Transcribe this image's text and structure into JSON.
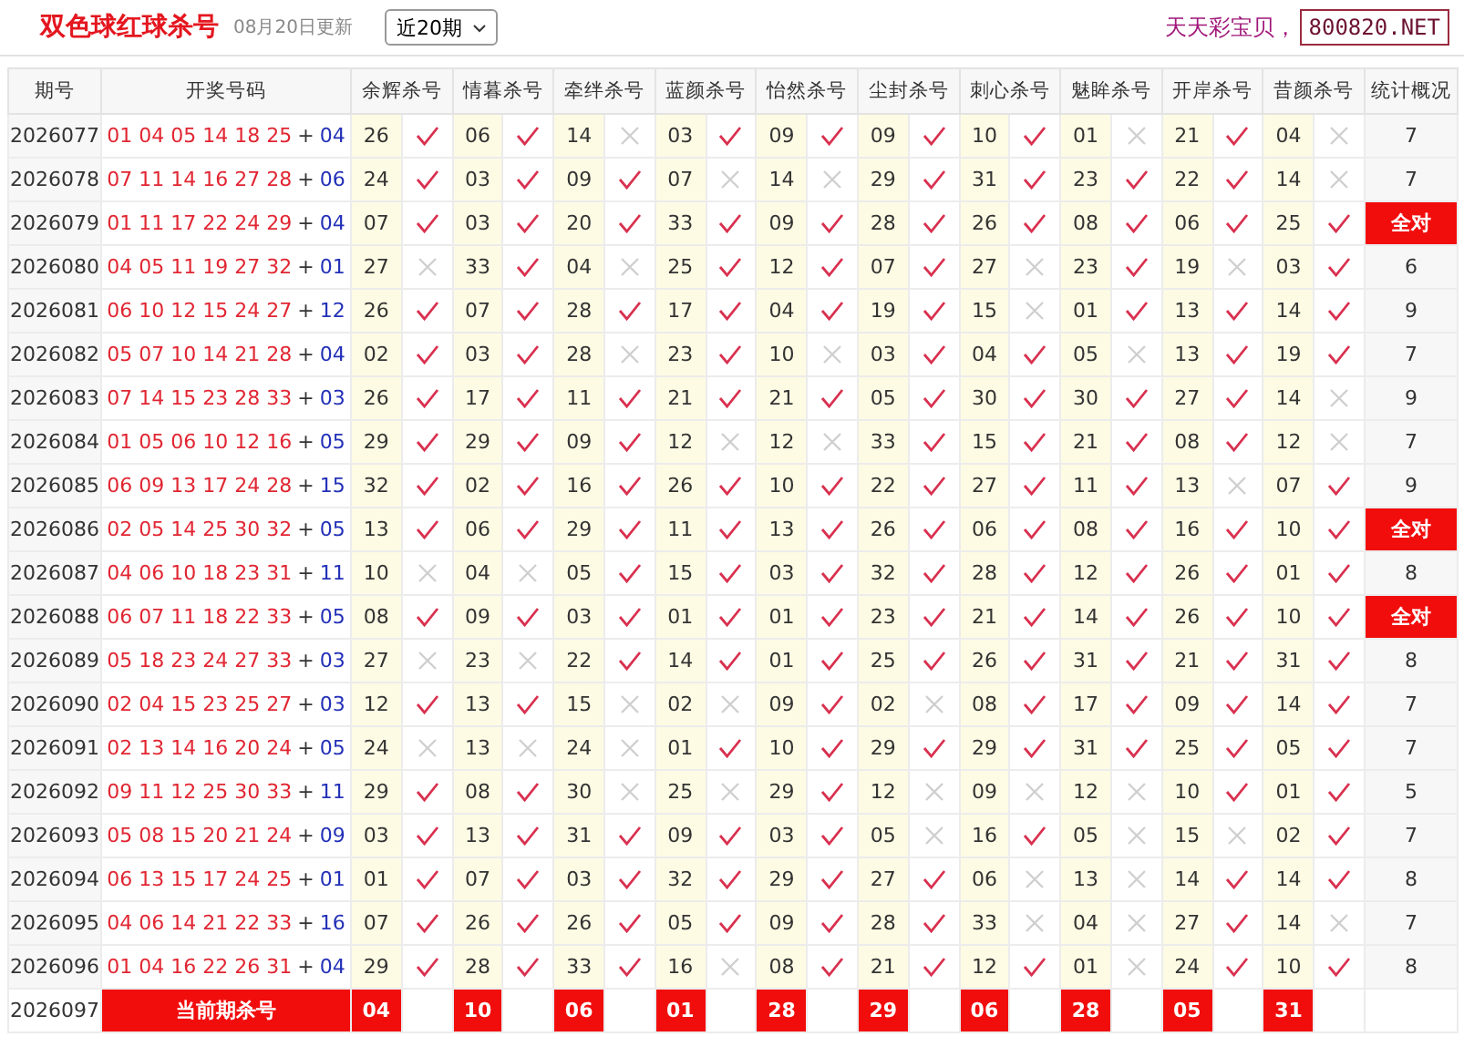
{
  "header": {
    "title": "双色球红球杀号",
    "updated": "08月20日更新",
    "period_select": {
      "value": "近20期"
    },
    "promo": "天天彩宝贝，",
    "site": "800820.NET"
  },
  "table": {
    "columns": [
      "期号",
      "开奖号码",
      "余辉杀号",
      "情暮杀号",
      "牵绊杀号",
      "蓝颜杀号",
      "怡然杀号",
      "尘封杀号",
      "刺心杀号",
      "魅眸杀号",
      "开岸杀号",
      "昔颜杀号",
      "统计概况"
    ],
    "rows": [
      {
        "issue": "2026077",
        "red": "01 04 05 14 18 25",
        "plus": "+",
        "blue": "04",
        "kills": [
          {
            "number": "26",
            "hit": true
          },
          {
            "number": "06",
            "hit": true
          },
          {
            "number": "14",
            "hit": false
          },
          {
            "number": "03",
            "hit": true
          },
          {
            "number": "09",
            "hit": true
          },
          {
            "number": "09",
            "hit": true
          },
          {
            "number": "10",
            "hit": true
          },
          {
            "number": "01",
            "hit": false
          },
          {
            "number": "21",
            "hit": true
          },
          {
            "number": "04",
            "hit": false
          }
        ],
        "summary": "7",
        "highlight": false
      },
      {
        "issue": "2026078",
        "red": "07 11 14 16 27 28",
        "plus": "+",
        "blue": "06",
        "kills": [
          {
            "number": "24",
            "hit": true
          },
          {
            "number": "03",
            "hit": true
          },
          {
            "number": "09",
            "hit": true
          },
          {
            "number": "07",
            "hit": false
          },
          {
            "number": "14",
            "hit": false
          },
          {
            "number": "29",
            "hit": true
          },
          {
            "number": "31",
            "hit": true
          },
          {
            "number": "23",
            "hit": true
          },
          {
            "number": "22",
            "hit": true
          },
          {
            "number": "14",
            "hit": false
          }
        ],
        "summary": "7",
        "highlight": false
      },
      {
        "issue": "2026079",
        "red": "01 11 17 22 24 29",
        "plus": "+",
        "blue": "04",
        "kills": [
          {
            "number": "07",
            "hit": true
          },
          {
            "number": "03",
            "hit": true
          },
          {
            "number": "20",
            "hit": true
          },
          {
            "number": "33",
            "hit": true
          },
          {
            "number": "09",
            "hit": true
          },
          {
            "number": "28",
            "hit": true
          },
          {
            "number": "26",
            "hit": true
          },
          {
            "number": "08",
            "hit": true
          },
          {
            "number": "06",
            "hit": true
          },
          {
            "number": "25",
            "hit": true
          }
        ],
        "summary": "全对",
        "highlight": true
      },
      {
        "issue": "2026080",
        "red": "04 05 11 19 27 32",
        "plus": "+",
        "blue": "01",
        "kills": [
          {
            "number": "27",
            "hit": false
          },
          {
            "number": "33",
            "hit": true
          },
          {
            "number": "04",
            "hit": false
          },
          {
            "number": "25",
            "hit": true
          },
          {
            "number": "12",
            "hit": true
          },
          {
            "number": "07",
            "hit": true
          },
          {
            "number": "27",
            "hit": false
          },
          {
            "number": "23",
            "hit": true
          },
          {
            "number": "19",
            "hit": false
          },
          {
            "number": "03",
            "hit": true
          }
        ],
        "summary": "6",
        "highlight": false
      },
      {
        "issue": "2026081",
        "red": "06 10 12 15 24 27",
        "plus": "+",
        "blue": "12",
        "kills": [
          {
            "number": "26",
            "hit": true
          },
          {
            "number": "07",
            "hit": true
          },
          {
            "number": "28",
            "hit": true
          },
          {
            "number": "17",
            "hit": true
          },
          {
            "number": "04",
            "hit": true
          },
          {
            "number": "19",
            "hit": true
          },
          {
            "number": "15",
            "hit": false
          },
          {
            "number": "01",
            "hit": true
          },
          {
            "number": "13",
            "hit": true
          },
          {
            "number": "14",
            "hit": true
          }
        ],
        "summary": "9",
        "highlight": false
      },
      {
        "issue": "2026082",
        "red": "05 07 10 14 21 28",
        "plus": "+",
        "blue": "04",
        "kills": [
          {
            "number": "02",
            "hit": true
          },
          {
            "number": "03",
            "hit": true
          },
          {
            "number": "28",
            "hit": false
          },
          {
            "number": "23",
            "hit": true
          },
          {
            "number": "10",
            "hit": false
          },
          {
            "number": "03",
            "hit": true
          },
          {
            "number": "04",
            "hit": true
          },
          {
            "number": "05",
            "hit": false
          },
          {
            "number": "13",
            "hit": true
          },
          {
            "number": "19",
            "hit": true
          }
        ],
        "summary": "7",
        "highlight": false
      },
      {
        "issue": "2026083",
        "red": "07 14 15 23 28 33",
        "plus": "+",
        "blue": "03",
        "kills": [
          {
            "number": "26",
            "hit": true
          },
          {
            "number": "17",
            "hit": true
          },
          {
            "number": "11",
            "hit": true
          },
          {
            "number": "21",
            "hit": true
          },
          {
            "number": "21",
            "hit": true
          },
          {
            "number": "05",
            "hit": true
          },
          {
            "number": "30",
            "hit": true
          },
          {
            "number": "30",
            "hit": true
          },
          {
            "number": "27",
            "hit": true
          },
          {
            "number": "14",
            "hit": false
          }
        ],
        "summary": "9",
        "highlight": false
      },
      {
        "issue": "2026084",
        "red": "01 05 06 10 12 16",
        "plus": "+",
        "blue": "05",
        "kills": [
          {
            "number": "29",
            "hit": true
          },
          {
            "number": "29",
            "hit": true
          },
          {
            "number": "09",
            "hit": true
          },
          {
            "number": "12",
            "hit": false
          },
          {
            "number": "12",
            "hit": false
          },
          {
            "number": "33",
            "hit": true
          },
          {
            "number": "15",
            "hit": true
          },
          {
            "number": "21",
            "hit": true
          },
          {
            "number": "08",
            "hit": true
          },
          {
            "number": "12",
            "hit": false
          }
        ],
        "summary": "7",
        "highlight": false
      },
      {
        "issue": "2026085",
        "red": "06 09 13 17 24 28",
        "plus": "+",
        "blue": "15",
        "kills": [
          {
            "number": "32",
            "hit": true
          },
          {
            "number": "02",
            "hit": true
          },
          {
            "number": "16",
            "hit": true
          },
          {
            "number": "26",
            "hit": true
          },
          {
            "number": "10",
            "hit": true
          },
          {
            "number": "22",
            "hit": true
          },
          {
            "number": "27",
            "hit": true
          },
          {
            "number": "11",
            "hit": true
          },
          {
            "number": "13",
            "hit": false
          },
          {
            "number": "07",
            "hit": true
          }
        ],
        "summary": "9",
        "highlight": false
      },
      {
        "issue": "2026086",
        "red": "02 05 14 25 30 32",
        "plus": "+",
        "blue": "05",
        "kills": [
          {
            "number": "13",
            "hit": true
          },
          {
            "number": "06",
            "hit": true
          },
          {
            "number": "29",
            "hit": true
          },
          {
            "number": "11",
            "hit": true
          },
          {
            "number": "13",
            "hit": true
          },
          {
            "number": "26",
            "hit": true
          },
          {
            "number": "06",
            "hit": true
          },
          {
            "number": "08",
            "hit": true
          },
          {
            "number": "16",
            "hit": true
          },
          {
            "number": "10",
            "hit": true
          }
        ],
        "summary": "全对",
        "highlight": true
      },
      {
        "issue": "2026087",
        "red": "04 06 10 18 23 31",
        "plus": "+",
        "blue": "11",
        "kills": [
          {
            "number": "10",
            "hit": false
          },
          {
            "number": "04",
            "hit": false
          },
          {
            "number": "05",
            "hit": true
          },
          {
            "number": "15",
            "hit": true
          },
          {
            "number": "03",
            "hit": true
          },
          {
            "number": "32",
            "hit": true
          },
          {
            "number": "28",
            "hit": true
          },
          {
            "number": "12",
            "hit": true
          },
          {
            "number": "26",
            "hit": true
          },
          {
            "number": "01",
            "hit": true
          }
        ],
        "summary": "8",
        "highlight": false
      },
      {
        "issue": "2026088",
        "red": "06 07 11 18 22 33",
        "plus": "+",
        "blue": "05",
        "kills": [
          {
            "number": "08",
            "hit": true
          },
          {
            "number": "09",
            "hit": true
          },
          {
            "number": "03",
            "hit": true
          },
          {
            "number": "01",
            "hit": true
          },
          {
            "number": "01",
            "hit": true
          },
          {
            "number": "23",
            "hit": true
          },
          {
            "number": "21",
            "hit": true
          },
          {
            "number": "14",
            "hit": true
          },
          {
            "number": "26",
            "hit": true
          },
          {
            "number": "10",
            "hit": true
          }
        ],
        "summary": "全对",
        "highlight": true
      },
      {
        "issue": "2026089",
        "red": "05 18 23 24 27 33",
        "plus": "+",
        "blue": "03",
        "kills": [
          {
            "number": "27",
            "hit": false
          },
          {
            "number": "23",
            "hit": false
          },
          {
            "number": "22",
            "hit": true
          },
          {
            "number": "14",
            "hit": true
          },
          {
            "number": "01",
            "hit": true
          },
          {
            "number": "25",
            "hit": true
          },
          {
            "number": "26",
            "hit": true
          },
          {
            "number": "31",
            "hit": true
          },
          {
            "number": "21",
            "hit": true
          },
          {
            "number": "31",
            "hit": true
          }
        ],
        "summary": "8",
        "highlight": false
      },
      {
        "issue": "2026090",
        "red": "02 04 15 23 25 27",
        "plus": "+",
        "blue": "03",
        "kills": [
          {
            "number": "12",
            "hit": true
          },
          {
            "number": "13",
            "hit": true
          },
          {
            "number": "15",
            "hit": false
          },
          {
            "number": "02",
            "hit": false
          },
          {
            "number": "09",
            "hit": true
          },
          {
            "number": "02",
            "hit": false
          },
          {
            "number": "08",
            "hit": true
          },
          {
            "number": "17",
            "hit": true
          },
          {
            "number": "09",
            "hit": true
          },
          {
            "number": "14",
            "hit": true
          }
        ],
        "summary": "7",
        "highlight": false
      },
      {
        "issue": "2026091",
        "red": "02 13 14 16 20 24",
        "plus": "+",
        "blue": "05",
        "kills": [
          {
            "number": "24",
            "hit": false
          },
          {
            "number": "13",
            "hit": false
          },
          {
            "number": "24",
            "hit": false
          },
          {
            "number": "01",
            "hit": true
          },
          {
            "number": "10",
            "hit": true
          },
          {
            "number": "29",
            "hit": true
          },
          {
            "number": "29",
            "hit": true
          },
          {
            "number": "31",
            "hit": true
          },
          {
            "number": "25",
            "hit": true
          },
          {
            "number": "05",
            "hit": true
          }
        ],
        "summary": "7",
        "highlight": false
      },
      {
        "issue": "2026092",
        "red": "09 11 12 25 30 33",
        "plus": "+",
        "blue": "11",
        "kills": [
          {
            "number": "29",
            "hit": true
          },
          {
            "number": "08",
            "hit": true
          },
          {
            "number": "30",
            "hit": false
          },
          {
            "number": "25",
            "hit": false
          },
          {
            "number": "29",
            "hit": true
          },
          {
            "number": "12",
            "hit": false
          },
          {
            "number": "09",
            "hit": false
          },
          {
            "number": "12",
            "hit": false
          },
          {
            "number": "10",
            "hit": true
          },
          {
            "number": "01",
            "hit": true
          }
        ],
        "summary": "5",
        "highlight": false
      },
      {
        "issue": "2026093",
        "red": "05 08 15 20 21 24",
        "plus": "+",
        "blue": "09",
        "kills": [
          {
            "number": "03",
            "hit": true
          },
          {
            "number": "13",
            "hit": true
          },
          {
            "number": "31",
            "hit": true
          },
          {
            "number": "09",
            "hit": true
          },
          {
            "number": "03",
            "hit": true
          },
          {
            "number": "05",
            "hit": false
          },
          {
            "number": "16",
            "hit": true
          },
          {
            "number": "05",
            "hit": false
          },
          {
            "number": "15",
            "hit": false
          },
          {
            "number": "02",
            "hit": true
          }
        ],
        "summary": "7",
        "highlight": false
      },
      {
        "issue": "2026094",
        "red": "06 13 15 17 24 25",
        "plus": "+",
        "blue": "01",
        "kills": [
          {
            "number": "01",
            "hit": true
          },
          {
            "number": "07",
            "hit": true
          },
          {
            "number": "03",
            "hit": true
          },
          {
            "number": "32",
            "hit": true
          },
          {
            "number": "29",
            "hit": true
          },
          {
            "number": "27",
            "hit": true
          },
          {
            "number": "06",
            "hit": false
          },
          {
            "number": "13",
            "hit": false
          },
          {
            "number": "14",
            "hit": true
          },
          {
            "number": "14",
            "hit": true
          }
        ],
        "summary": "8",
        "highlight": false
      },
      {
        "issue": "2026095",
        "red": "04 06 14 21 22 33",
        "plus": "+",
        "blue": "16",
        "kills": [
          {
            "number": "07",
            "hit": true
          },
          {
            "number": "26",
            "hit": true
          },
          {
            "number": "26",
            "hit": true
          },
          {
            "number": "05",
            "hit": true
          },
          {
            "number": "09",
            "hit": true
          },
          {
            "number": "28",
            "hit": true
          },
          {
            "number": "33",
            "hit": false
          },
          {
            "number": "04",
            "hit": false
          },
          {
            "number": "27",
            "hit": true
          },
          {
            "number": "14",
            "hit": false
          }
        ],
        "summary": "7",
        "highlight": false
      },
      {
        "issue": "2026096",
        "red": "01 04 16 22 26 31",
        "plus": "+",
        "blue": "04",
        "kills": [
          {
            "number": "29",
            "hit": true
          },
          {
            "number": "28",
            "hit": true
          },
          {
            "number": "33",
            "hit": true
          },
          {
            "number": "16",
            "hit": false
          },
          {
            "number": "08",
            "hit": true
          },
          {
            "number": "21",
            "hit": true
          },
          {
            "number": "12",
            "hit": true
          },
          {
            "number": "01",
            "hit": false
          },
          {
            "number": "24",
            "hit": true
          },
          {
            "number": "10",
            "hit": true
          }
        ],
        "summary": "8",
        "highlight": false
      }
    ],
    "current": {
      "issue": "2026097",
      "label": "当前期杀号",
      "kills": [
        "04",
        "10",
        "06",
        "01",
        "28",
        "29",
        "06",
        "28",
        "05",
        "31"
      ]
    }
  }
}
